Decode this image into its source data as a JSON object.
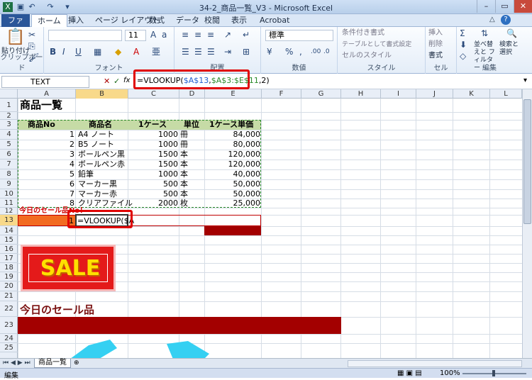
{
  "window": {
    "title": "34-2_商品一覧_V3 - Microsoft Excel"
  },
  "tabs": [
    "ファイル",
    "ホーム",
    "挿入",
    "ページ レイアウト",
    "数式",
    "データ",
    "校閲",
    "表示",
    "Acrobat"
  ],
  "ribbon": {
    "paste": "貼り付け",
    "clipboard": "クリップボード",
    "font_name": "",
    "font_size": "11",
    "font": "フォント",
    "align": "配置",
    "number_format": "標準",
    "number": "数値",
    "style": "スタイル",
    "cond_format": "条件付き書式",
    "table_format": "テーブルとして書式設定",
    "cell_style": "セルのスタイル",
    "insert": "挿入",
    "delete": "削除",
    "format": "書式",
    "cells": "セル",
    "sort": "並べ替えと フィルター",
    "find": "検索と 選択",
    "edit": "編集"
  },
  "formula_bar": {
    "name_box": "TEXT",
    "fx": "fx",
    "formula_prefix": "=VLOOKUP(",
    "ref1": "$A$13",
    "comma1": ",",
    "ref2": "$A$3:$E$11",
    "tail": ",2)"
  },
  "columns": [
    "A",
    "B",
    "C",
    "D",
    "E",
    "F",
    "G",
    "H",
    "I",
    "J",
    "K",
    "L"
  ],
  "rows": [
    "1",
    "2",
    "3",
    "4",
    "5",
    "6",
    "7",
    "8",
    "9",
    "10",
    "11",
    "12",
    "13",
    "14",
    "15",
    "16",
    "17",
    "18",
    "19",
    "20",
    "21",
    "22",
    "23",
    "24",
    "25"
  ],
  "sheet": {
    "title": "商品一覧",
    "headers": [
      "商品No",
      "商品名",
      "1ケース",
      "単位",
      "1ケース単価"
    ],
    "table": [
      [
        "1",
        "A4 ノート",
        "1000",
        "冊",
        "84,000"
      ],
      [
        "2",
        "B5 ノート",
        "1000",
        "冊",
        "80,000"
      ],
      [
        "3",
        "ボールペン黒",
        "1500",
        "本",
        "120,000"
      ],
      [
        "4",
        "ボールペン赤",
        "1500",
        "本",
        "120,000"
      ],
      [
        "5",
        "鉛筆",
        "1000",
        "本",
        "40,000"
      ],
      [
        "6",
        "マーカー黒",
        "500",
        "本",
        "50,000"
      ],
      [
        "7",
        "マーカー赤",
        "500",
        "本",
        "50,000"
      ],
      [
        "8",
        "クリアファイル",
        "2000",
        "枚",
        "25,000"
      ]
    ],
    "sale_label": "今日のセール品No！",
    "a13": "1",
    "b13": "=VLOOKUP($A",
    "sale_badge": "SALE",
    "today_sale": "今日のセール品"
  },
  "sheet_tab": "商品一覧",
  "status": {
    "mode": "編集",
    "zoom": "100%"
  },
  "colors": {
    "header_green": "#c6dba6",
    "dark_red": "#a30000",
    "orange": "#f26b21",
    "red": "#e00000"
  }
}
